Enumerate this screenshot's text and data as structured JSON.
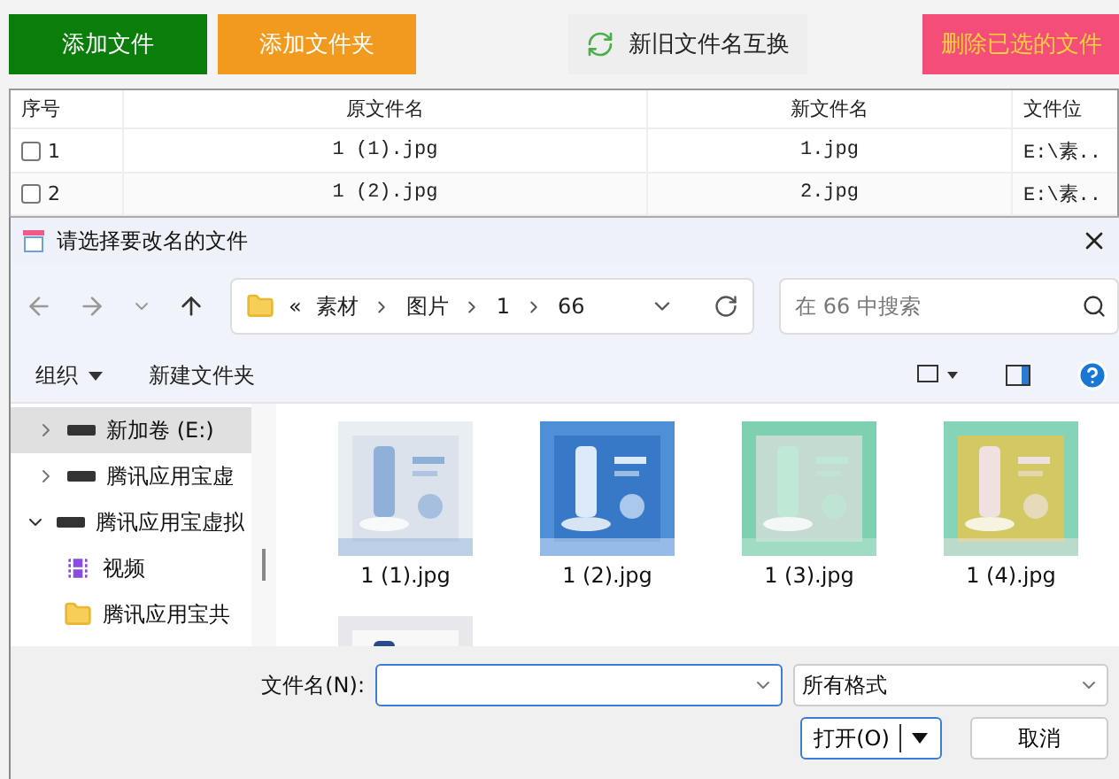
{
  "toolbar": {
    "buttons": [
      {
        "label": "添加文件",
        "kind": "green"
      },
      {
        "label": "添加文件夹",
        "kind": "orange"
      },
      {
        "label": "新旧文件名互换",
        "kind": "swap"
      },
      {
        "label": "删除已选的文件",
        "kind": "pink"
      }
    ]
  },
  "table": {
    "columns": [
      "序号",
      "原文件名",
      "新文件名",
      "文件位"
    ],
    "rows": [
      {
        "index": "1",
        "checked": false,
        "original": "1 (1).jpg",
        "new": "1.jpg",
        "location": "E:\\素.."
      },
      {
        "index": "2",
        "checked": false,
        "original": "1 (2).jpg",
        "new": "2.jpg",
        "location": "E:\\素.."
      }
    ]
  },
  "dialog": {
    "title": "请选择要改名的文件",
    "address": {
      "overflow": "«",
      "crumbs": [
        "素材",
        "图片",
        "1",
        "66"
      ]
    },
    "search": {
      "placeholder": "在 66 中搜索"
    },
    "commands": [
      "组织",
      "新建文件夹"
    ],
    "sidebar": [
      {
        "label": "新加卷 (E:)",
        "kind": "drive",
        "expanded": false,
        "selected": true
      },
      {
        "label": "腾讯应用宝虚",
        "kind": "drive",
        "expanded": false,
        "selected": false
      },
      {
        "label": "腾讯应用宝虚拟",
        "kind": "drive",
        "expanded": true,
        "selected": false,
        "children": [
          {
            "label": "视频",
            "kind": "video",
            "selected": false
          },
          {
            "label": "腾讯应用宝共",
            "kind": "folder",
            "selected": false
          }
        ]
      }
    ],
    "files": [
      {
        "name": "1 (1).jpg",
        "kind": "picture"
      },
      {
        "name": "1 (2).jpg",
        "kind": "picture"
      },
      {
        "name": "1 (3).jpg",
        "kind": "picture"
      },
      {
        "name": "1 (4).jpg",
        "kind": "picture"
      },
      {
        "kind": "picture"
      }
    ],
    "filename": {
      "label": "文件名(N):"
    },
    "filetype": {
      "value": "所有格式"
    },
    "buttons": [
      {
        "label": "打开(O)",
        "kind": "split"
      },
      {
        "label": "取消",
        "kind": "plain"
      }
    ]
  }
}
